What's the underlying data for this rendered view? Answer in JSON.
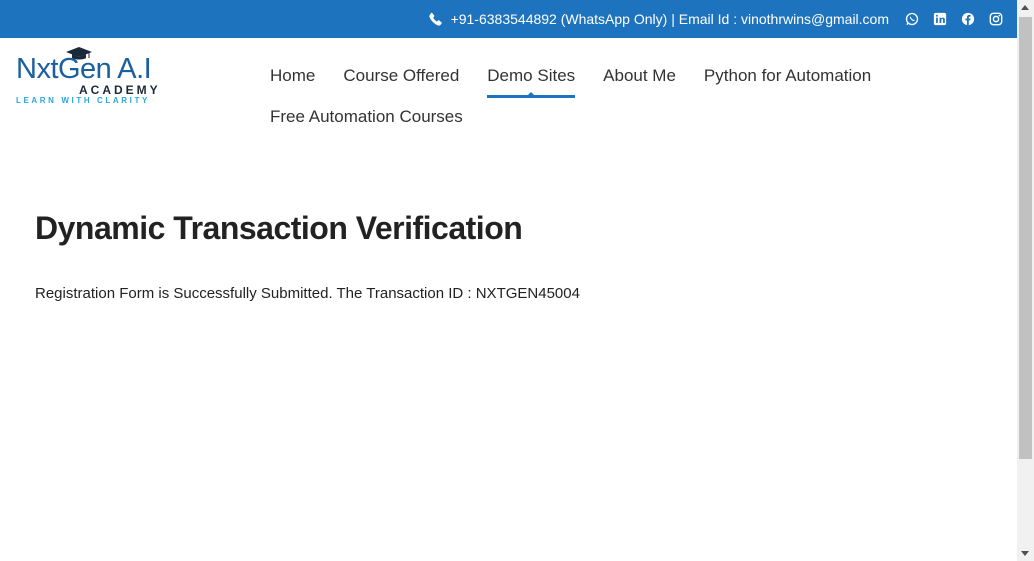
{
  "topbar": {
    "contact_text": "+91-6383544892 (WhatsApp Only) | Email Id : vinothrwins@gmail.com",
    "icons": [
      "phone-icon",
      "whatsapp-icon",
      "linkedin-icon",
      "facebook-icon",
      "instagram-icon"
    ],
    "background": "#1e73be"
  },
  "logo": {
    "brand": "NxtGen A.I",
    "academy": "ACADEMY",
    "tagline": "LEARN WITH CLARITY"
  },
  "nav": {
    "items": [
      {
        "label": "Home",
        "active": false
      },
      {
        "label": "Course Offered",
        "active": false
      },
      {
        "label": "Demo Sites",
        "active": true
      },
      {
        "label": "About Me",
        "active": false
      },
      {
        "label": "Python for Automation",
        "active": false
      },
      {
        "label": "Free Automation Courses",
        "active": false
      }
    ],
    "accent": "#1e73be"
  },
  "main": {
    "title": "Dynamic Transaction Verification",
    "message": "Registration Form is Successfully Submitted. The Transaction ID : NXTGEN45004"
  }
}
